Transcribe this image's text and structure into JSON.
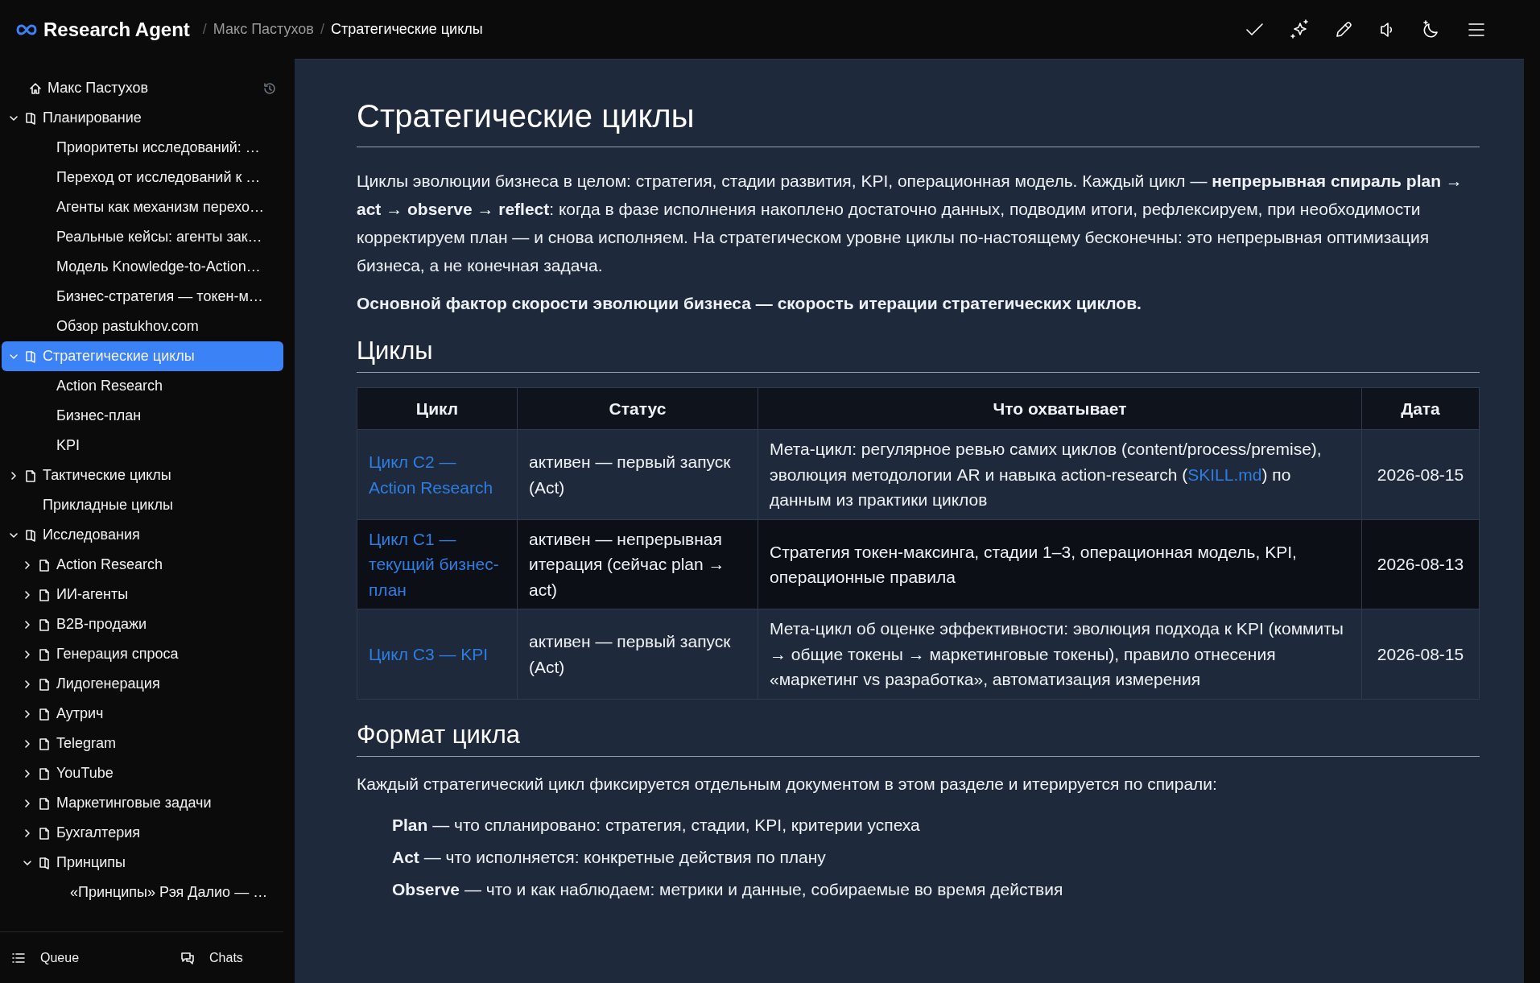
{
  "app": {
    "title": "Research Agent"
  },
  "breadcrumbs": [
    {
      "separator": "/",
      "label": "Макс Пастухов",
      "current": false
    },
    {
      "separator": "/",
      "label": "Стратегические циклы",
      "current": true
    }
  ],
  "sidebar": {
    "home": {
      "label": "Макс Пастухов"
    },
    "tree": [
      {
        "label": "Планирование",
        "expanded": true,
        "selected": false,
        "children": [
          {
            "label": "Приоритеты исследований: …",
            "selected": false
          },
          {
            "label": "Переход от исследований к …",
            "selected": false
          },
          {
            "label": "Агенты как механизм перехо…",
            "selected": false
          },
          {
            "label": "Реальные кейсы: агенты зак…",
            "selected": false
          },
          {
            "label": "Модель Knowledge-to-Action…",
            "selected": false
          },
          {
            "label": "Бизнес-стратегия — токен-м…",
            "selected": false
          },
          {
            "label": "Обзор pastukhov.com",
            "selected": false
          }
        ]
      },
      {
        "label": "Стратегические циклы",
        "expanded": true,
        "selected": true,
        "children": [
          {
            "label": "Action Research",
            "selected": false
          },
          {
            "label": "Бизнес-план",
            "selected": false
          },
          {
            "label": "KPI",
            "selected": false
          }
        ]
      },
      {
        "label": "Тактические циклы",
        "expanded": false,
        "selected": false
      },
      {
        "label": "Прикладные циклы",
        "selected": false
      },
      {
        "label": "Исследования",
        "expanded": true,
        "selected": false,
        "children": [
          {
            "label": "Action Research",
            "expanded": false,
            "selected": false
          },
          {
            "label": "ИИ-агенты",
            "expanded": false,
            "selected": false
          },
          {
            "label": "B2B-продажи",
            "expanded": false,
            "selected": false
          },
          {
            "label": "Генерация спроса",
            "expanded": false,
            "selected": false
          },
          {
            "label": "Лидогенерация",
            "expanded": false,
            "selected": false
          },
          {
            "label": "Аутрич",
            "expanded": false,
            "selected": false
          },
          {
            "label": "Telegram",
            "expanded": false,
            "selected": false
          },
          {
            "label": "YouTube",
            "expanded": false,
            "selected": false
          },
          {
            "label": "Маркетинговые задачи",
            "expanded": false,
            "selected": false
          },
          {
            "label": "Бухгалтерия",
            "expanded": false,
            "selected": false
          },
          {
            "label": "Принципы",
            "expanded": true,
            "selected": false,
            "children": [
              {
                "label": "«Принципы» Рэя Далио — …",
                "selected": false
              }
            ]
          }
        ]
      }
    ],
    "footer": [
      {
        "label": "Queue"
      },
      {
        "label": "Chats"
      }
    ]
  },
  "document": {
    "title": "Стратегические циклы",
    "intro": [
      {
        "text": "Циклы эволюции бизнеса в целом: стратегия, стадии развития, KPI, операционная модель. Каждый цикл — **непрерывная спираль plan** → **act** → **observe** → **reflect**: когда в фазе исполнения накоплено достаточно данных, подводим итоги, рефлексируем, при необходимости корректируем план — и снова исполняем. На стратегическом уровне циклы по-настоящему бесконечны: это непрерывная оптимизация бизнеса, а не конечная задача.",
        "bold": false
      },
      {
        "text": "Основной фактор скорости эволюции бизнеса — скорость итерации стратегических циклов.",
        "bold": true
      }
    ],
    "cycles": {
      "heading": "Циклы",
      "table": {
        "columns": [
          "Цикл",
          "Статус",
          "Что охватывает",
          "Дата"
        ],
        "rows": [
          {
            "cycle": "Цикл C2 — Action Research",
            "status": "активен — первый запуск (Act)",
            "scope": [
              {
                "text": "Мета-цикл: регулярное ревью самих циклов (content/process/premise), эволюция методологии AR и навыка action-research ("
              },
              {
                "text": "SKILL.md",
                "link": true
              },
              {
                "text": ") по данным из практики циклов"
              }
            ],
            "date": "2026-08-15"
          },
          {
            "cycle": "Цикл C1 — текущий бизнес-план",
            "status": "активен — непрерывная итерация (сейчас plan → act)",
            "scope": [
              {
                "text": "Стратегия токен-максинга, стадии 1–3, операционная модель, KPI, операционные правила"
              }
            ],
            "date": "2026-08-13"
          },
          {
            "cycle": "Цикл C3 — KPI",
            "status": "активен — первый запуск (Act)",
            "scope": [
              {
                "text": "Мета-цикл об оценке эффективности: эволюция подхода к KPI (коммиты → общие токены → маркетинговые токены), правило отнесения «маркетинг vs разработка», автоматизация измерения"
              }
            ],
            "date": "2026-08-15"
          }
        ]
      }
    },
    "format": {
      "heading": "Формат цикла",
      "text": "Каждый стратегический цикл фиксируется отдельным документом в этом разделе и итерируется по спирали:",
      "items": [
        "**Plan** — что спланировано: стратегия, стадии, KPI, критерии успеха",
        "**Act** — что исполняется: конкретные действия по плану",
        "**Observe** — что и как наблюдаем: метрики и данные, собираемые во время действия"
      ]
    }
  }
}
